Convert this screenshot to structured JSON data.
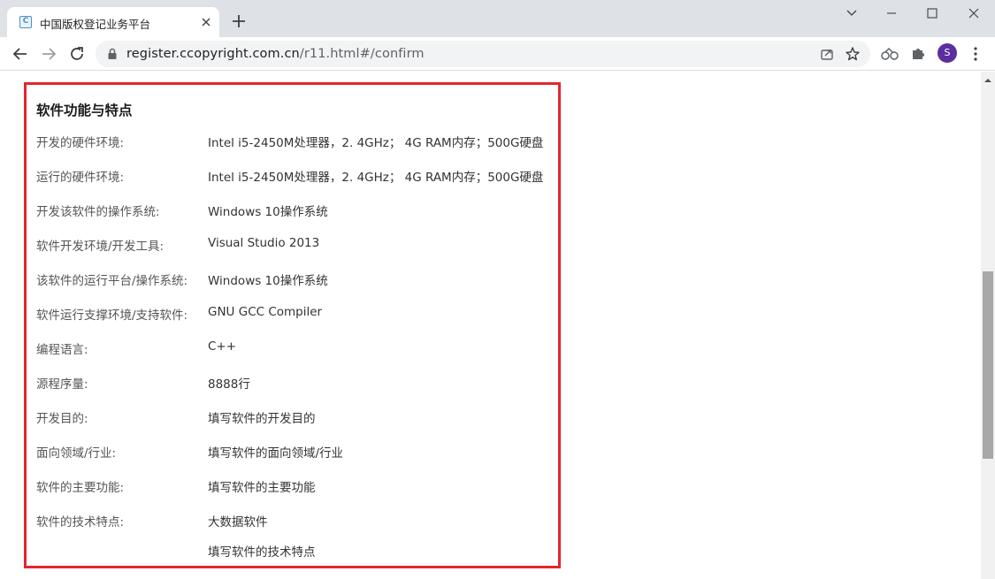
{
  "browser": {
    "tab_title": "中国版权登记业务平台",
    "favicon_letter": "C",
    "url_host": "register.ccopyright.com.cn",
    "url_path": "/r11.html#/confirm",
    "avatar_letter": "S"
  },
  "section": {
    "title": "软件功能与特点",
    "rows": [
      {
        "label": "开发的硬件环境:",
        "value": "Intel i5-2450M处理器，2. 4GHz； 4G RAM内存；500G硬盘"
      },
      {
        "label": "运行的硬件环境:",
        "value": "Intel i5-2450M处理器，2. 4GHz； 4G RAM内存；500G硬盘"
      },
      {
        "label": "开发该软件的操作系统:",
        "value": "Windows 10操作系统"
      },
      {
        "label": "软件开发环境/开发工具:",
        "value": "Visual Studio 2013"
      },
      {
        "label": "该软件的运行平台/操作系统:",
        "value": "Windows 10操作系统"
      },
      {
        "label": "软件运行支撑环境/支持软件:",
        "value": "GNU GCC Compiler"
      },
      {
        "label": "编程语言:",
        "value": "C++"
      },
      {
        "label": "源程序量:",
        "value": "8888行"
      },
      {
        "label": "开发目的:",
        "value": "填写软件的开发目的"
      },
      {
        "label": "面向领域/行业:",
        "value": "填写软件的面向领域/行业"
      },
      {
        "label": "软件的主要功能:",
        "value": "填写软件的主要功能"
      },
      {
        "label": "软件的技术特点:",
        "value": "大数据软件",
        "value2": "填写软件的技术特点"
      }
    ]
  },
  "colors": {
    "highlight_border": "#e3262e",
    "tabstrip_bg": "#dee1e6",
    "avatar_bg": "#5b2d9f"
  }
}
